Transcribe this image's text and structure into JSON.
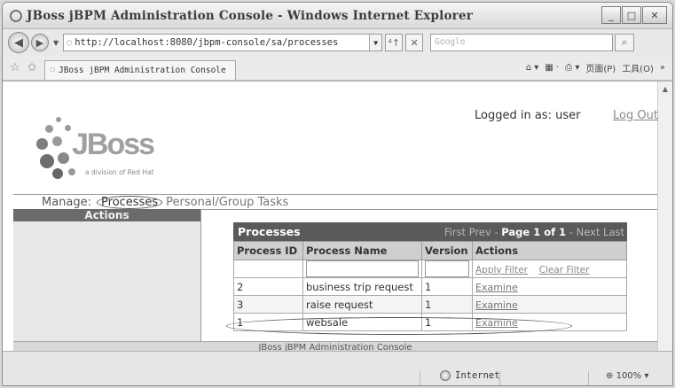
{
  "window": {
    "title": "JBoss jBPM Administration Console - Windows Internet Explorer",
    "min_glyph": "_",
    "max_glyph": "□",
    "close_glyph": "✕"
  },
  "toolbar": {
    "back_glyph": "◀",
    "forward_glyph": "▶",
    "url": "http://localhost:8080/jbpm-console/sa/processes",
    "refresh_glyph": "⁴↑",
    "stop_glyph": "✕",
    "search_placeholder": "Google",
    "search_glyph": "⌕"
  },
  "tabs": {
    "active_tab": "JBoss jBPM Administration Console",
    "tools": [
      "页面(P)",
      "工具(O)"
    ]
  },
  "page": {
    "logged_in": "Logged in as: user",
    "logout": "Log Out",
    "logo_text": "JBoss",
    "logo_tag": "a division of Red Hat",
    "manage_label": "Manage:",
    "nav_processes": "Processes",
    "nav_tasks": "Personal/Group Tasks",
    "sidebar_title": "Actions",
    "footer": "JBoss jBPM Administration Console"
  },
  "processes": {
    "title": "Processes",
    "pager": {
      "prev": "First Prev",
      "sep": " - ",
      "current": "Page 1 of 1",
      "next": " - Next Last"
    },
    "columns": [
      "Process ID",
      "Process Name",
      "Version",
      "Actions"
    ],
    "apply_filter": "Apply Filter",
    "clear_filter": "Clear Filter",
    "rows": [
      {
        "id": "2",
        "name": "business trip request",
        "version": "1",
        "action": "Examine"
      },
      {
        "id": "3",
        "name": "raise request",
        "version": "1",
        "action": "Examine"
      },
      {
        "id": "1",
        "name": "websale",
        "version": "1",
        "action": "Examine"
      }
    ]
  },
  "status": {
    "zone": "Internet",
    "zoom": "100%"
  }
}
